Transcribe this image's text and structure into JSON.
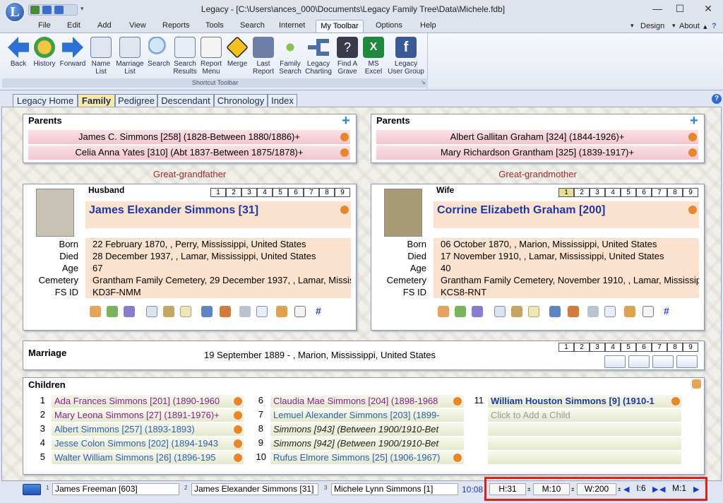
{
  "title": "Legacy - [C:\\Users\\ances_000\\Documents\\Legacy Family Tree\\Data\\Michele.fdb]",
  "logo_letter": "L",
  "menu": [
    "File",
    "Edit",
    "Add",
    "View",
    "Reports",
    "Tools",
    "Search",
    "Internet",
    "My Toolbar",
    "Options",
    "Help"
  ],
  "right_menu": {
    "design": "Design",
    "about": "About"
  },
  "toolbar": {
    "back": "Back",
    "history": "History",
    "forward": "Forward",
    "name_list": "Name List",
    "marriage_list": "Marriage List",
    "search": "Search",
    "search_results": "Search Results",
    "report_menu": "Report Menu",
    "merge": "Merge",
    "last_report": "Last Report",
    "family_search": "Family Search",
    "legacy_charting": "Legacy Charting",
    "find_a_grave": "Find A Grave",
    "ms_excel": "MS Excel",
    "legacy_user_group": "Legacy User Group",
    "group_label": "Shortcut Toolbar"
  },
  "tabs": [
    "Legacy Home",
    "Family",
    "Pedigree",
    "Descendant",
    "Chronology",
    "Index"
  ],
  "active_tab": "Family",
  "husband_parents": {
    "title": "Parents",
    "father": "James C. Simmons [258] (1828-Between 1880/1886)+",
    "mother": "Celia Anna Yates [310] (Abt 1837-Between 1875/1878)+",
    "relation": "Great-grandfather"
  },
  "wife_parents": {
    "title": "Parents",
    "father": "Albert Gallitan Graham [324] (1844-1926)+",
    "mother": "Mary Richardson Grantham [325] (1839-1917)+",
    "relation": "Great-grandmother"
  },
  "husband": {
    "role": "Husband",
    "name": "James Elexander Simmons [31]",
    "labels": {
      "born": "Born",
      "died": "Died",
      "age": "Age",
      "cemetery": "Cemetery",
      "fsid": "FS ID"
    },
    "born": "22 February 1870, , Perry, Mississippi, United States",
    "died": "28 December 1937, , Lamar, Mississippi, United States",
    "age": "67",
    "cemetery": "Grantham Family Cemetery, 29 December 1937, , Lamar, Mississi",
    "fsid": "KD3F-NMM"
  },
  "wife": {
    "role": "Wife",
    "name": "Corrine Elizabeth Graham [200]",
    "labels": {
      "born": "Born",
      "died": "Died",
      "age": "Age",
      "cemetery": "Cemetery",
      "fsid": "FS ID"
    },
    "born": "06 October 1870, , Marion, Mississippi, United States",
    "died": "17 November 1910, , Lamar, Mississippi, United States",
    "age": "40",
    "cemetery": "Grantham Family Cemetery, November 1910, , Lamar, Mississip",
    "fsid": "KCS8-RNT"
  },
  "spouse_numbers": [
    "1",
    "2",
    "3",
    "4",
    "5",
    "6",
    "7",
    "8",
    "9"
  ],
  "marriage": {
    "title": "Marriage",
    "text": "19 September 1889 - , Marion, Mississippi, United States"
  },
  "children": {
    "title": "Children",
    "col1": [
      {
        "n": "1",
        "text": "Ada Frances Simmons [201] (1890-1960"
      },
      {
        "n": "2",
        "text": "Mary Leona Simmons [27] (1891-1976)+"
      },
      {
        "n": "3",
        "text": "Albert Simmons [257] (1893-1893)"
      },
      {
        "n": "4",
        "text": "Jesse Colon Simmons [202] (1894-1943"
      },
      {
        "n": "5",
        "text": "Walter William Simmons [26] (1896-195"
      }
    ],
    "col2": [
      {
        "n": "6",
        "text": "Claudia Mae Simmons [204] (1898-1968"
      },
      {
        "n": "7",
        "text": "Lemuel Alexander Simmons [203] (1899-"
      },
      {
        "n": "8",
        "text": "Simmons [943] (Between 1900/1910-Bet"
      },
      {
        "n": "9",
        "text": "Simmons [942] (Between 1900/1910-Bet"
      },
      {
        "n": "10",
        "text": "Rufus Elmore Simmons [25] (1906-1967)"
      }
    ],
    "col3": [
      {
        "n": "11",
        "text": "William Houston Simmons [9] (1910-1"
      },
      {
        "n": "",
        "text": "Click to Add a Child"
      }
    ]
  },
  "status": {
    "f1_num": "1",
    "f1": "James Freeman [603]",
    "f2_num": "2",
    "f2": "James Elexander Simmons [31]",
    "f3_num": "3",
    "f3": "Michele Lynn Simmons [1]",
    "time": "10:08",
    "h": "H:31",
    "m": "M:10",
    "w": "W:200",
    "i": "I:6",
    "m1": "M:1"
  }
}
